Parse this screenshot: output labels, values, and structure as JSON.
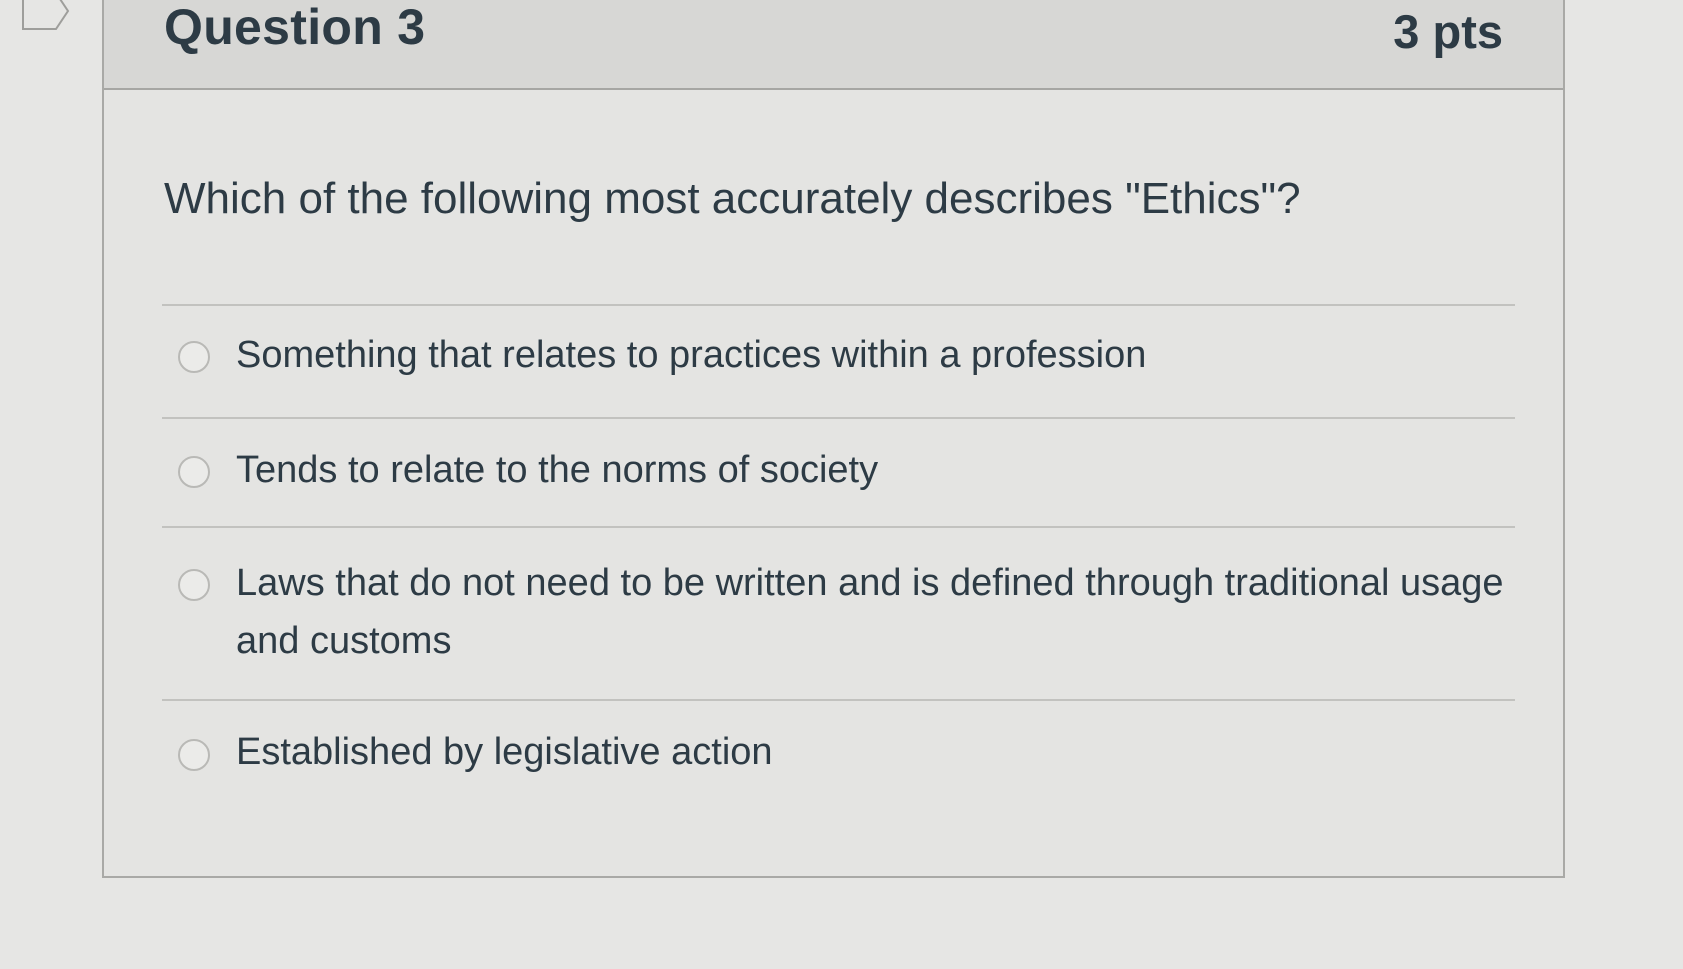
{
  "question": {
    "title": "Question 3",
    "points": "3 pts",
    "text": "Which of the following most accurately describes \"Ethics\"?",
    "answers": [
      {
        "label": "Something that relates to practices within a profession",
        "selected": false
      },
      {
        "label": "Tends to relate to the norms of society",
        "selected": false
      },
      {
        "label": "Laws that do not need to be written and is defined through traditional usage and customs",
        "selected": false
      },
      {
        "label": "Established by legislative action",
        "selected": false
      }
    ]
  },
  "icons": {
    "bookmark": "bookmark-flag-icon",
    "radio": "radio-button-icon"
  },
  "colors": {
    "text": "#2d3b45",
    "header_bg": "#d7d7d5",
    "card_bg": "#e4e4e2",
    "border": "#a9a9a6"
  }
}
